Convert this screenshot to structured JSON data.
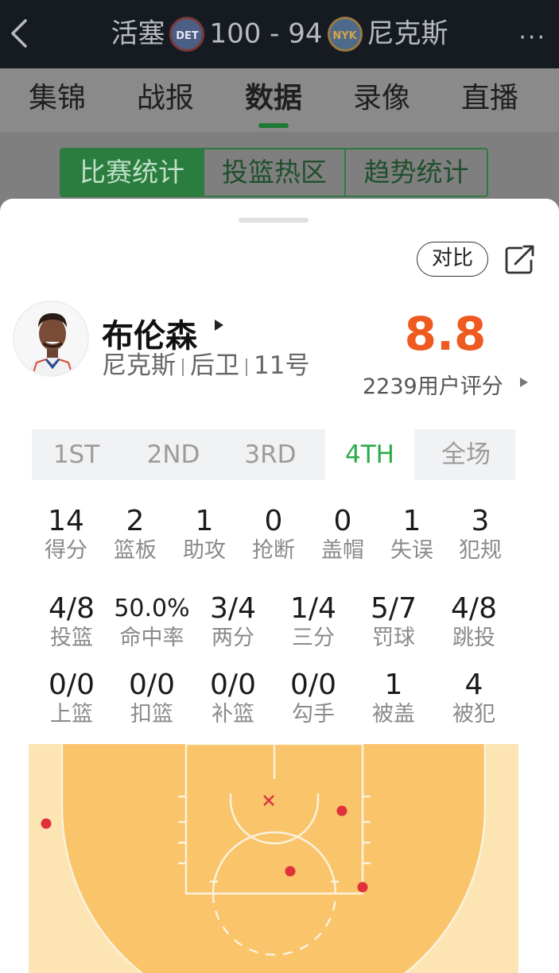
{
  "header": {
    "home_team": "活塞",
    "home_logo_text": "DET",
    "score": "100 - 94",
    "away_logo_text": "NYK",
    "away_team": "尼克斯",
    "more": "···"
  },
  "tabs": [
    {
      "label": "集锦"
    },
    {
      "label": "战报"
    },
    {
      "label": "数据"
    },
    {
      "label": "录像"
    },
    {
      "label": "直播"
    }
  ],
  "segments": [
    {
      "label": "比赛统计"
    },
    {
      "label": "投篮热区"
    },
    {
      "label": "趋势统计"
    }
  ],
  "actions": {
    "compare": "对比"
  },
  "player": {
    "name": "布伦森",
    "team": "尼克斯",
    "position": "后卫",
    "number": "11号",
    "rating": "8.8",
    "rating_count": "2239用户评分"
  },
  "periods": [
    {
      "label": "1ST"
    },
    {
      "label": "2ND"
    },
    {
      "label": "3RD"
    },
    {
      "label": "4TH"
    },
    {
      "label": "全场"
    }
  ],
  "stats_row1": [
    {
      "value": "14",
      "label": "得分"
    },
    {
      "value": "2",
      "label": "篮板"
    },
    {
      "value": "1",
      "label": "助攻"
    },
    {
      "value": "0",
      "label": "抢断"
    },
    {
      "value": "0",
      "label": "盖帽"
    },
    {
      "value": "1",
      "label": "失误"
    },
    {
      "value": "3",
      "label": "犯规"
    }
  ],
  "stats_row2": [
    {
      "value": "4/8",
      "label": "投篮"
    },
    {
      "value": "50.0%",
      "label": "命中率"
    },
    {
      "value": "3/4",
      "label": "两分"
    },
    {
      "value": "1/4",
      "label": "三分"
    },
    {
      "value": "5/7",
      "label": "罚球"
    },
    {
      "value": "4/8",
      "label": "跳投"
    }
  ],
  "stats_row3": [
    {
      "value": "0/0",
      "label": "上篮"
    },
    {
      "value": "0/0",
      "label": "扣篮"
    },
    {
      "value": "0/0",
      "label": "补篮"
    },
    {
      "value": "0/0",
      "label": "勾手"
    },
    {
      "value": "1",
      "label": "被盖"
    },
    {
      "value": "4",
      "label": "被犯"
    }
  ],
  "colors": {
    "accent_green": "#2eaa4a",
    "rating_orange": "#ee5a1f",
    "made_shot": "#e0303a",
    "court": "#f9c46a"
  }
}
